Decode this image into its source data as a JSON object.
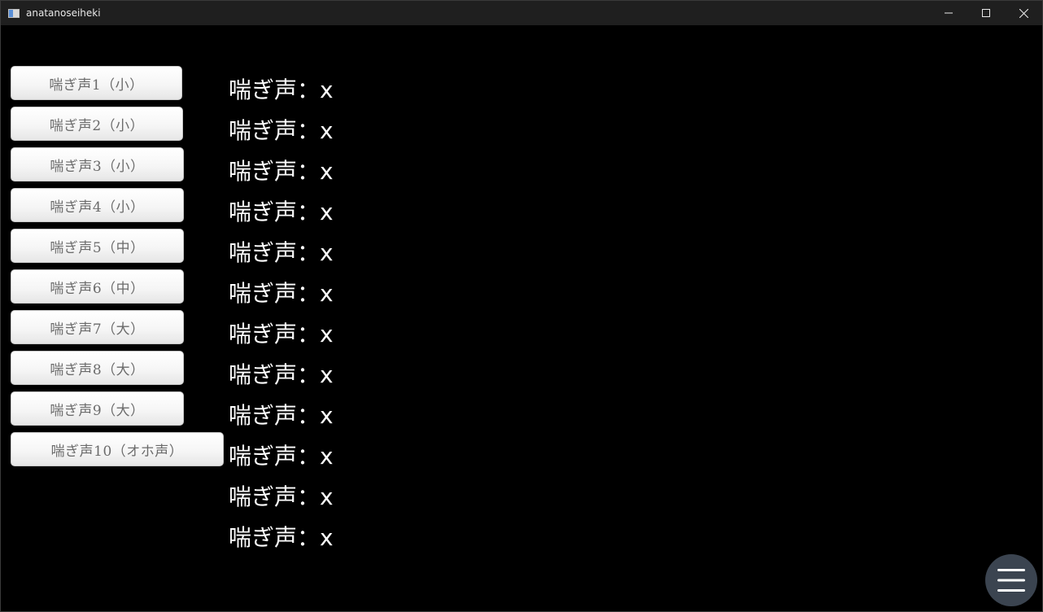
{
  "window": {
    "title": "anatanoseiheki"
  },
  "buttons": [
    {
      "label": "喘ぎ声1（小）"
    },
    {
      "label": "喘ぎ声2（小）"
    },
    {
      "label": "喘ぎ声3（小）"
    },
    {
      "label": "喘ぎ声4（小）"
    },
    {
      "label": "喘ぎ声5（中）"
    },
    {
      "label": "喘ぎ声6（中）"
    },
    {
      "label": "喘ぎ声7（大）"
    },
    {
      "label": "喘ぎ声8（大）"
    },
    {
      "label": "喘ぎ声9（大）"
    },
    {
      "label": "喘ぎ声10（オホ声）"
    }
  ],
  "labels": [
    {
      "text": "喘ぎ声：x"
    },
    {
      "text": "喘ぎ声：x"
    },
    {
      "text": "喘ぎ声：x"
    },
    {
      "text": "喘ぎ声：x"
    },
    {
      "text": "喘ぎ声：x"
    },
    {
      "text": "喘ぎ声：x"
    },
    {
      "text": "喘ぎ声：x"
    },
    {
      "text": "喘ぎ声：x"
    },
    {
      "text": "喘ぎ声：x"
    },
    {
      "text": "喘ぎ声：x"
    },
    {
      "text": "喘ぎ声：x"
    },
    {
      "text": "喘ぎ声：x"
    }
  ],
  "icons": {
    "app": "app-window-icon",
    "minimize": "minimize-icon",
    "maximize": "maximize-icon",
    "close": "close-icon",
    "menu": "hamburger-menu-icon"
  },
  "colors": {
    "background": "#000000",
    "titlebar": "#1f1f1f",
    "fab": "#3b4450"
  }
}
